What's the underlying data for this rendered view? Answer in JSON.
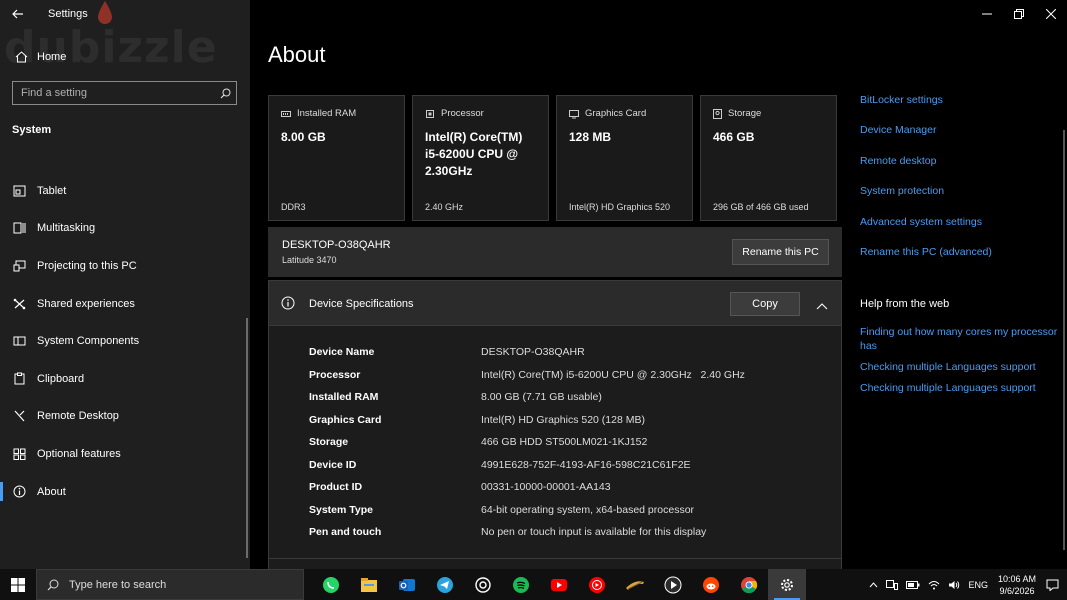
{
  "window": {
    "title": "Settings"
  },
  "watermark": "dubizzle",
  "sidebar": {
    "home_label": "Home",
    "search_placeholder": "Find a setting",
    "section_label": "System",
    "items": [
      {
        "label": "Tablet",
        "icon": "tablet-icon"
      },
      {
        "label": "Multitasking",
        "icon": "multitasking-icon"
      },
      {
        "label": "Projecting to this PC",
        "icon": "projecting-icon"
      },
      {
        "label": "Shared experiences",
        "icon": "shared-experiences-icon"
      },
      {
        "label": "System Components",
        "icon": "system-components-icon"
      },
      {
        "label": "Clipboard",
        "icon": "clipboard-icon"
      },
      {
        "label": "Remote Desktop",
        "icon": "remote-desktop-icon"
      },
      {
        "label": "Optional features",
        "icon": "optional-features-icon"
      },
      {
        "label": "About",
        "icon": "about-icon",
        "active": true
      }
    ]
  },
  "page": {
    "title": "About"
  },
  "cards": [
    {
      "label": "Installed RAM",
      "value": "8.00 GB",
      "sub": "DDR3",
      "icon": "ram-icon"
    },
    {
      "label": "Processor",
      "value": "Intel(R) Core(TM) i5-6200U CPU @ 2.30GHz",
      "sub": "2.40 GHz",
      "icon": "processor-icon"
    },
    {
      "label": "Graphics Card",
      "value": "128 MB",
      "sub": "Intel(R) HD Graphics 520",
      "icon": "graphics-card-icon"
    },
    {
      "label": "Storage",
      "value": "466 GB",
      "sub": "296 GB of 466 GB used",
      "icon": "storage-icon"
    }
  ],
  "pc": {
    "name": "DESKTOP-O38QAHR",
    "model": "Latitude 3470",
    "rename_label": "Rename this PC"
  },
  "specs": {
    "title": "Device Specifications",
    "copy_label": "Copy",
    "rows": [
      {
        "key": "Device Name",
        "value": "DESKTOP-O38QAHR"
      },
      {
        "key": "Processor",
        "value": "Intel(R) Core(TM) i5-6200U CPU @ 2.30GHz   2.40 GHz"
      },
      {
        "key": "Installed RAM",
        "value": "8.00 GB (7.71 GB usable)"
      },
      {
        "key": "Graphics Card",
        "value": "Intel(R) HD Graphics 520 (128 MB)"
      },
      {
        "key": "Storage",
        "value": "466 GB HDD ST500LM021-1KJ152"
      },
      {
        "key": "Device ID",
        "value": "4991E628-752F-4193-AF16-598C21C61F2E"
      },
      {
        "key": "Product ID",
        "value": "00331-10000-00001-AA143"
      },
      {
        "key": "System Type",
        "value": "64-bit operating system, x64-based processor"
      },
      {
        "key": "Pen and touch",
        "value": "No pen or touch input is available for this display"
      }
    ]
  },
  "related_links": [
    "BitLocker settings",
    "Device Manager",
    "Remote desktop",
    "System protection",
    "Advanced system settings",
    "Rename this PC (advanced)"
  ],
  "help": {
    "title": "Help from the web",
    "links": [
      "Finding out how many cores my processor has",
      "Checking multiple Languages support",
      "Checking multiple Languages support"
    ]
  },
  "taskbar": {
    "search_placeholder": "Type here to search",
    "apps": [
      "whatsapp-icon",
      "file-explorer-icon",
      "outlook-icon",
      "telegram-icon",
      "chatgpt-icon",
      "spotify-icon",
      "youtube-icon",
      "youtube-music-icon",
      "sword-game-icon",
      "media-player-icon",
      "reddit-icon",
      "chrome-icon",
      "settings-icon"
    ],
    "lang": "ENG",
    "time": "10:06 AM",
    "date": "9/6/2026"
  },
  "colors": {
    "accent": "#4a9cf2",
    "sidebar_bg": "#1f1f1f",
    "card_bg": "#1a1a1a"
  }
}
